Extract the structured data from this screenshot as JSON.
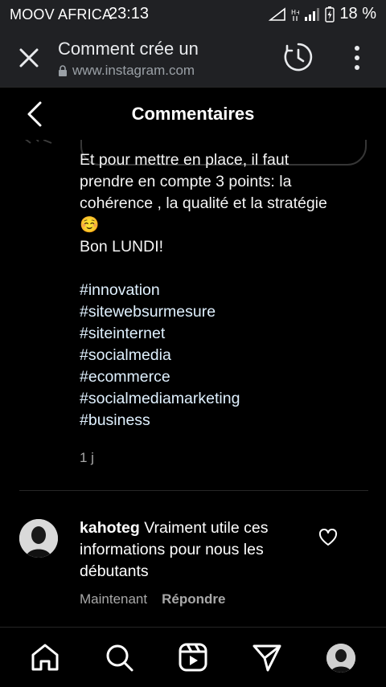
{
  "status_bar": {
    "carrier": "MOOV AFRICA",
    "time": "23:13",
    "battery": "18 %"
  },
  "browser": {
    "page_title": "Comment crée un",
    "url": "www.instagram.com"
  },
  "header": {
    "title": "Commentaires"
  },
  "post": {
    "caption_cut_line": "Et pour mettre en place, il faut",
    "caption_lines": [
      "prendre en compte 3 points: la",
      "cohérence , la qualité et la stratégie",
      "☺️",
      "Bon LUNDI!"
    ],
    "hashtags": [
      "#innovation",
      "#sitewebsurmesure",
      "#siteinternet",
      "#socialmedia",
      "#ecommerce",
      "#socialmediamarketing",
      "#business"
    ],
    "time_ago": "1 j"
  },
  "comment": {
    "username": "kahoteg",
    "text": "Vraiment utile ces informations pour nous les débutants",
    "time": "Maintenant",
    "reply_label": "Répondre"
  },
  "nav": {
    "icons": [
      "home-icon",
      "search-icon",
      "reels-icon",
      "direct-icon",
      "profile-avatar"
    ]
  }
}
